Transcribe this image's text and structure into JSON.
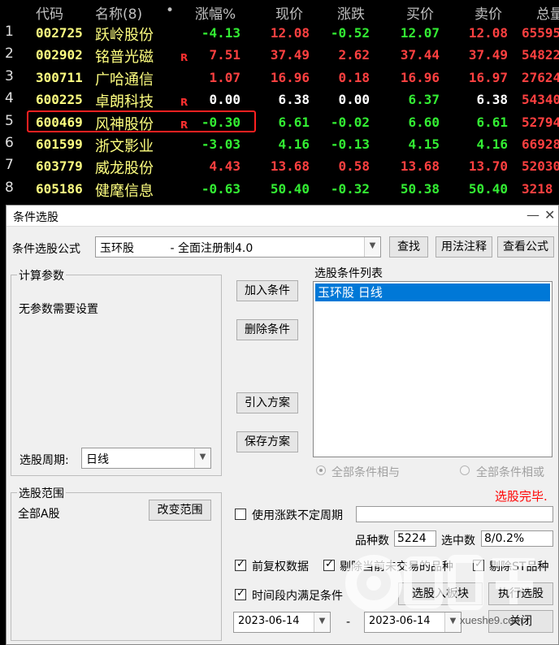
{
  "table": {
    "headers": {
      "code": "代码",
      "name": "名称(8)",
      "dot": "•",
      "pct": "涨幅%",
      "price": "现价",
      "chg": "涨跌",
      "buy": "买价",
      "sell": "卖价",
      "vol": "总量"
    },
    "rows": [
      {
        "idx": "1",
        "code": "002725",
        "name": "跃岭股份",
        "r": "",
        "pct": "-4.13",
        "price": "12.08",
        "chg": "-0.52",
        "buy": "12.07",
        "sell": "12.08",
        "vol": "65595",
        "trend": [
          "dn",
          "up",
          "dn",
          "dn",
          "up"
        ]
      },
      {
        "idx": "2",
        "code": "002902",
        "name": "铭普光磁",
        "r": "R",
        "pct": "7.51",
        "price": "37.49",
        "chg": "2.62",
        "buy": "37.44",
        "sell": "37.49",
        "vol": "54822",
        "trend": [
          "up",
          "up",
          "up",
          "up",
          "up"
        ]
      },
      {
        "idx": "3",
        "code": "300711",
        "name": "广哈通信",
        "r": "",
        "pct": "1.07",
        "price": "16.96",
        "chg": "0.18",
        "buy": "16.96",
        "sell": "16.97",
        "vol": "27624",
        "trend": [
          "up",
          "up",
          "up",
          "up",
          "up"
        ]
      },
      {
        "idx": "4",
        "code": "600225",
        "name": "卓朗科技",
        "r": "R",
        "pct": "0.00",
        "price": "6.38",
        "chg": "0.00",
        "buy": "6.37",
        "sell": "6.38",
        "vol": "54340",
        "trend": [
          "flat",
          "flat",
          "flat",
          "dn",
          "flat"
        ]
      },
      {
        "idx": "5",
        "code": "600469",
        "name": "风神股份",
        "r": "R",
        "pct": "-0.30",
        "price": "6.61",
        "chg": "-0.02",
        "buy": "6.60",
        "sell": "6.61",
        "vol": "52794",
        "trend": [
          "dn",
          "dn",
          "dn",
          "dn",
          "dn"
        ]
      },
      {
        "idx": "6",
        "code": "601599",
        "name": "浙文影业",
        "r": "",
        "pct": "-3.03",
        "price": "4.16",
        "chg": "-0.13",
        "buy": "4.15",
        "sell": "4.16",
        "vol": "66928",
        "trend": [
          "dn",
          "dn",
          "dn",
          "dn",
          "dn"
        ]
      },
      {
        "idx": "7",
        "code": "603779",
        "name": "威龙股份",
        "r": "",
        "pct": "4.43",
        "price": "13.68",
        "chg": "0.58",
        "buy": "13.68",
        "sell": "13.70",
        "vol": "52030",
        "trend": [
          "up",
          "up",
          "up",
          "up",
          "up"
        ]
      },
      {
        "idx": "8",
        "code": "605186",
        "name": "健麾信息",
        "r": "",
        "pct": "-0.63",
        "price": "50.40",
        "chg": "-0.32",
        "buy": "50.38",
        "sell": "50.40",
        "vol": "3218",
        "trend": [
          "dn",
          "dn",
          "dn",
          "dn",
          "dn"
        ]
      }
    ]
  },
  "dialog": {
    "title": "条件选股",
    "formula_label": "条件选股公式",
    "formula_value": "玉环股          - 全面注册制4.0",
    "find_btn": "查找",
    "usage_btn": "用法注释",
    "view_btn": "查看公式",
    "params_title": "计算参数",
    "params_text": "无参数需要设置",
    "add_btn": "加入条件",
    "del_btn": "删除条件",
    "import_btn": "引入方案",
    "save_btn": "保存方案",
    "cond_list_title": "选股条件列表",
    "cond_items": [
      "玉环股  日线"
    ],
    "period_label": "选股周期:",
    "period_value": "日线",
    "radio_and": "全部条件相与",
    "radio_or": "全部条件相或",
    "status": "选股完毕.",
    "range_title": "选股范围",
    "range_value": "全部A股",
    "range_btn": "改变范围",
    "use_range_label": "使用涨跌不定周期",
    "count_label": "品种数",
    "count_value": "5224",
    "selected_label": "选中数",
    "selected_value": "8/0.2%",
    "chk_restore": "前复权数据",
    "chk_exclude_untraded": "剔除当前未交易的品种",
    "chk_exclude_st": "剔除ST品种",
    "chk_period": "时间段内满足条件",
    "to_board_btn": "选股入板块",
    "run_btn": "执行选股",
    "date_from": "2023-06-14",
    "date_sep": "-",
    "date_to": "2023-06-14",
    "close_btn": "关闭"
  },
  "watermark": {
    "text": "xueshe9.com"
  },
  "colors": {
    "up": "#ff4040",
    "down": "#33ee33",
    "highlight": "#ff2020",
    "status": "#ff0000"
  }
}
